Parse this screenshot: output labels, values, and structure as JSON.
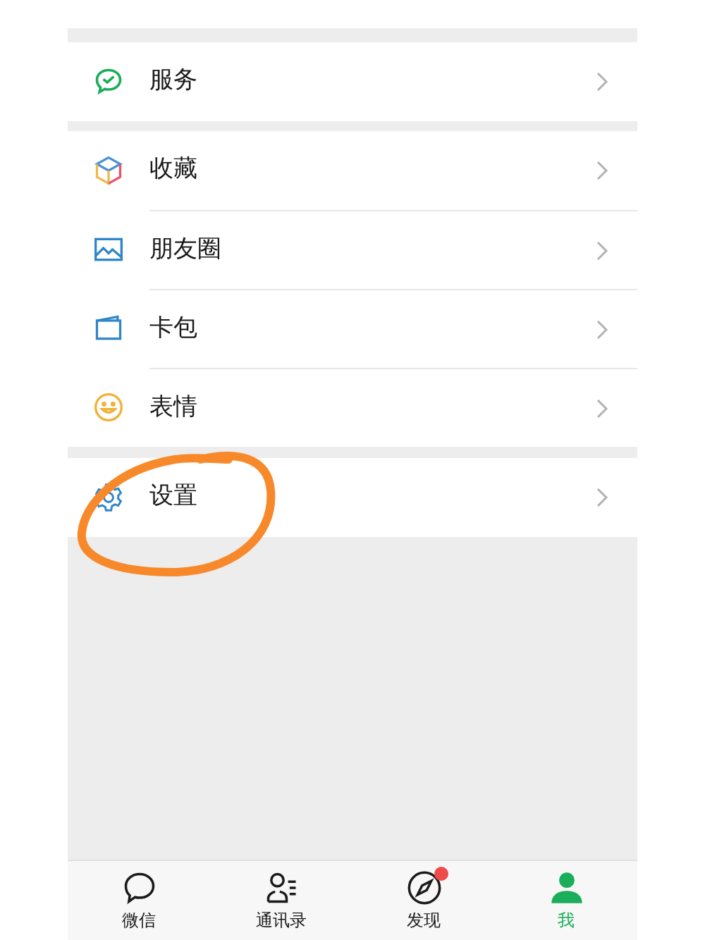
{
  "groups": [
    {
      "items": [
        {
          "label": "服务",
          "kind": "pay"
        }
      ]
    },
    {
      "items": [
        {
          "label": "收藏",
          "kind": "cube"
        },
        {
          "label": "朋友圈",
          "kind": "photo"
        },
        {
          "label": "卡包",
          "kind": "wallet"
        },
        {
          "label": "表情",
          "kind": "smile"
        }
      ]
    },
    {
      "items": [
        {
          "label": "设置",
          "kind": "gear"
        }
      ]
    }
  ],
  "tab_bar": [
    {
      "label": "微信",
      "kind": "chat",
      "selected": false,
      "badge": false
    },
    {
      "label": "通讯录",
      "kind": "contacts",
      "selected": false,
      "badge": false
    },
    {
      "label": "发现",
      "kind": "compass",
      "selected": false,
      "badge": true
    },
    {
      "label": "我",
      "kind": "person",
      "selected": true,
      "badge": false
    }
  ]
}
